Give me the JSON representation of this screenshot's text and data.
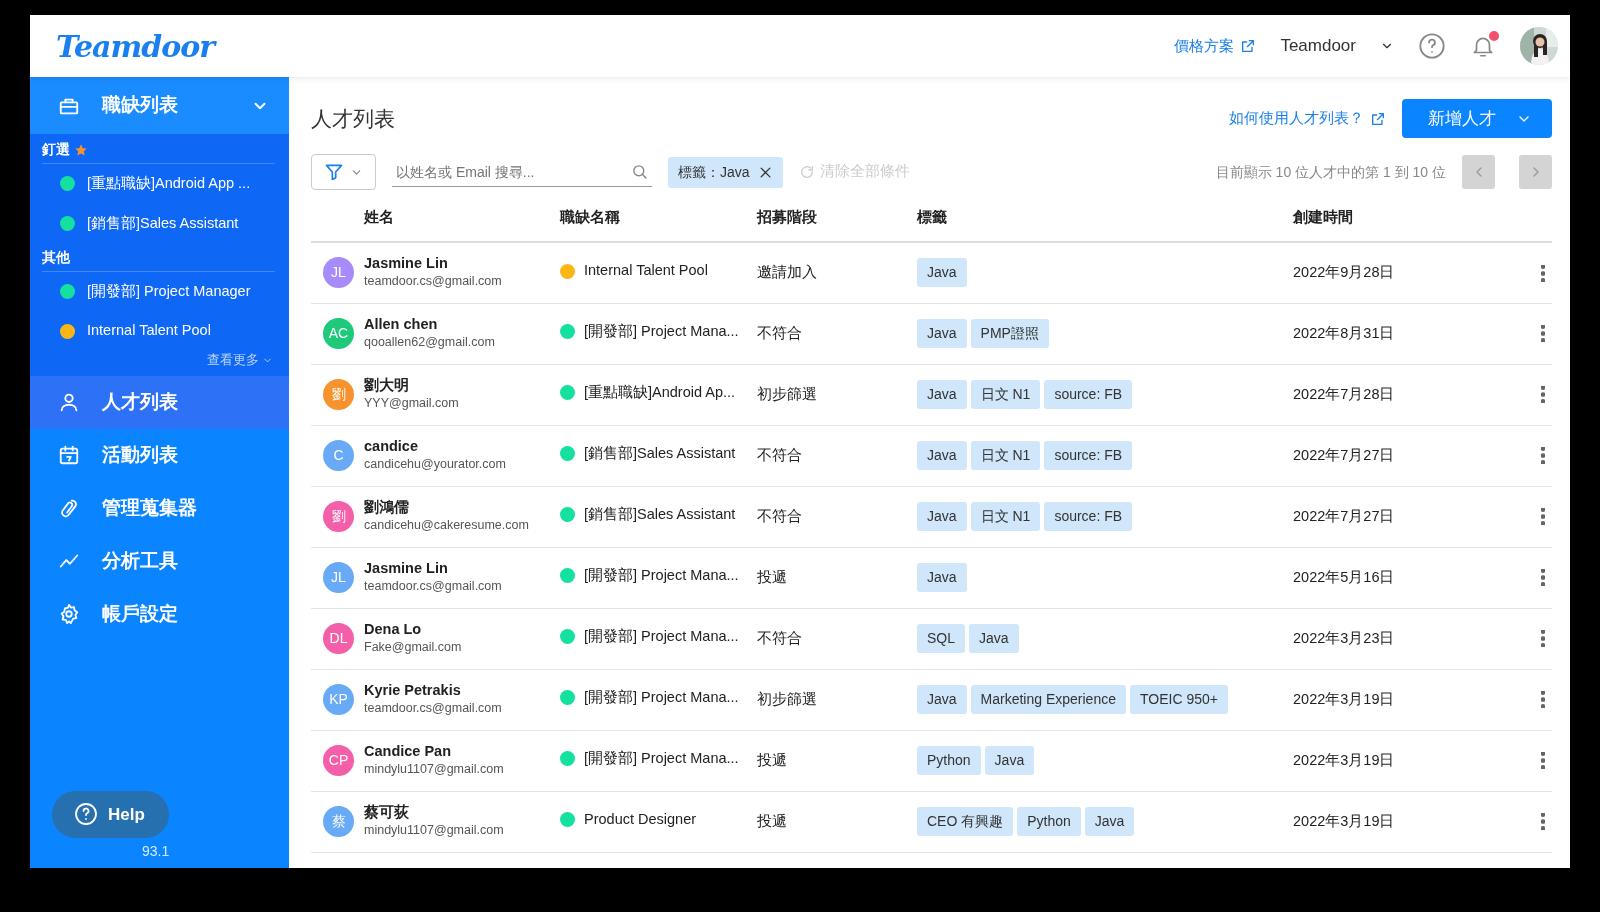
{
  "header": {
    "logo": "Teamdoor",
    "pricing_link": "價格方案",
    "workspace": "Teamdoor",
    "unread_notifications": true
  },
  "sidebar": {
    "jobs_menu": {
      "label": "職缺列表",
      "expanded": true,
      "groups": [
        {
          "title": "釘選",
          "pinned": true,
          "items": [
            {
              "label": "[重點職缺]Android App ...",
              "color": "#14e0a0"
            },
            {
              "label": "[銷售部]Sales Assistant",
              "color": "#14e0a0"
            }
          ]
        },
        {
          "title": "其他",
          "pinned": false,
          "items": [
            {
              "label": "[開發部] Project Manager",
              "color": "#14e0a0"
            },
            {
              "label": "Internal Talent Pool",
              "color": "#fbb614"
            }
          ]
        }
      ],
      "more": "查看更多"
    },
    "nav": [
      {
        "label": "人才列表",
        "selected": true
      },
      {
        "label": "活動列表",
        "selected": false
      },
      {
        "label": "管理蒐集器",
        "selected": false
      },
      {
        "label": "分析工具",
        "selected": false
      },
      {
        "label": "帳戶設定",
        "selected": false
      }
    ],
    "help": "Help",
    "version": "93.1"
  },
  "page": {
    "title": "人才列表",
    "help_link": "如何使用人才列表？",
    "add_button": "新增人才"
  },
  "filters": {
    "search_placeholder": "以姓名或 Email 搜尋...",
    "chips": [
      {
        "label": "標籤：Java"
      }
    ],
    "clear": "清除全部條件",
    "clear_disabled": true,
    "summary": "目前顯示 10 位人才中的第 1 到 10 位",
    "prev_disabled": true,
    "next_disabled": true
  },
  "table": {
    "columns": [
      "姓名",
      "職缺名稱",
      "招募階段",
      "標籤",
      "創建時間"
    ],
    "rows": [
      {
        "avatar": {
          "initials": "JL",
          "color": "#a78bfa"
        },
        "name": "Jasmine Lin",
        "email": "teamdoor.cs@gmail.com",
        "job": {
          "title": "Internal Talent Pool",
          "color": "#fbb614"
        },
        "stage": "邀請加入",
        "tags": [
          "Java"
        ],
        "created": "2022年9月28日"
      },
      {
        "avatar": {
          "initials": "AC",
          "color": "#1ec97a"
        },
        "name": "Allen chen",
        "email": "qooallen62@gmail.com",
        "job": {
          "title": "[開發部] Project Mana...",
          "color": "#14e0a0"
        },
        "stage": "不符合",
        "tags": [
          "Java",
          "PMP證照"
        ],
        "created": "2022年8月31日"
      },
      {
        "avatar": {
          "initials": "劉",
          "color": "#f7932f"
        },
        "name": "劉大明",
        "email": "YYY@gmail.com",
        "job": {
          "title": "[重點職缺]Android Ap...",
          "color": "#14e0a0"
        },
        "stage": "初步篩選",
        "tags": [
          "Java",
          "日文 N1",
          "source: FB"
        ],
        "created": "2022年7月28日"
      },
      {
        "avatar": {
          "initials": "C",
          "color": "#69aaf7"
        },
        "name": "candice",
        "email": "candicehu@yourator.com",
        "job": {
          "title": "[銷售部]Sales Assistant",
          "color": "#14e0a0"
        },
        "stage": "不符合",
        "tags": [
          "Java",
          "日文 N1",
          "source: FB"
        ],
        "created": "2022年7月27日"
      },
      {
        "avatar": {
          "initials": "劉",
          "color": "#f35fa8"
        },
        "name": "劉鴻儒",
        "email": "candicehu@cakeresume.com",
        "job": {
          "title": "[銷售部]Sales Assistant",
          "color": "#14e0a0"
        },
        "stage": "不符合",
        "tags": [
          "Java",
          "日文 N1",
          "source: FB"
        ],
        "created": "2022年7月27日"
      },
      {
        "avatar": {
          "initials": "JL",
          "color": "#69aaf7"
        },
        "name": "Jasmine Lin",
        "email": "teamdoor.cs@gmail.com",
        "job": {
          "title": "[開發部] Project Mana...",
          "color": "#14e0a0"
        },
        "stage": "投遞",
        "tags": [
          "Java"
        ],
        "created": "2022年5月16日"
      },
      {
        "avatar": {
          "initials": "DL",
          "color": "#f35fa8"
        },
        "name": "Dena Lo",
        "email": "Fake@gmail.com",
        "job": {
          "title": "[開發部] Project Mana...",
          "color": "#14e0a0"
        },
        "stage": "不符合",
        "tags": [
          "SQL",
          "Java"
        ],
        "created": "2022年3月23日"
      },
      {
        "avatar": {
          "initials": "KP",
          "color": "#69aaf7"
        },
        "name": "Kyrie Petrakis",
        "email": "teamdoor.cs@gmail.com",
        "job": {
          "title": "[開發部] Project Mana...",
          "color": "#14e0a0"
        },
        "stage": "初步篩選",
        "tags": [
          "Java",
          "Marketing Experience",
          "TOEIC 950+"
        ],
        "created": "2022年3月19日"
      },
      {
        "avatar": {
          "initials": "CP",
          "color": "#f35fa8"
        },
        "name": "Candice Pan",
        "email": "mindylu1107@gmail.com",
        "job": {
          "title": "[開發部] Project Mana...",
          "color": "#14e0a0"
        },
        "stage": "投遞",
        "tags": [
          "Python",
          "Java"
        ],
        "created": "2022年3月19日"
      },
      {
        "avatar": {
          "initials": "蔡",
          "color": "#69aaf7"
        },
        "name": "蔡可荻",
        "email": "mindylu1107@gmail.com",
        "job": {
          "title": "Product Designer",
          "color": "#14e0a0"
        },
        "stage": "投遞",
        "tags": [
          "CEO 有興趣",
          "Python",
          "Java"
        ],
        "created": "2022年3月19日"
      }
    ]
  }
}
